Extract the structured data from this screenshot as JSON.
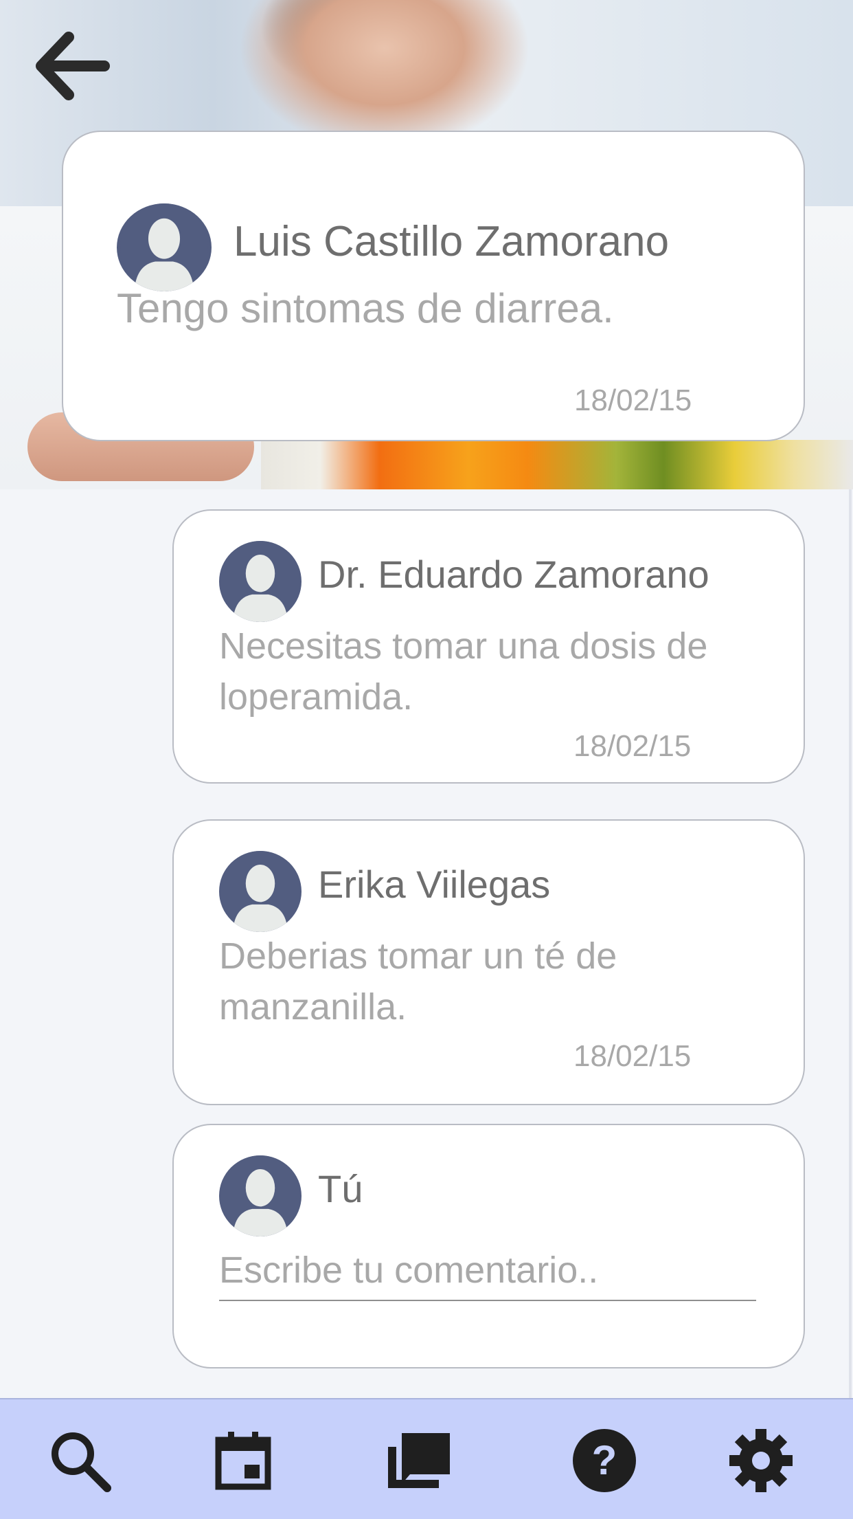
{
  "header": {
    "back_icon": "arrow-left-icon",
    "image": "doctor-fruit-banner"
  },
  "main_post": {
    "author": "Luis Castillo Zamorano",
    "message": "Tengo sintomas de diarrea.",
    "date": "18/02/15",
    "avatar_icon": "user-avatar-icon"
  },
  "comments": [
    {
      "author": "Dr. Eduardo Zamorano",
      "message": "Necesitas tomar una dosis de loperamida.",
      "date": "18/02/15",
      "avatar_icon": "user-avatar-icon"
    },
    {
      "author": "Erika Viilegas",
      "message": "Deberias tomar  un té de manzanilla.",
      "date": "18/02/15",
      "avatar_icon": "user-avatar-icon"
    }
  ],
  "compose": {
    "author": "Tú",
    "placeholder": "Escribe tu comentario..",
    "avatar_icon": "user-avatar-icon"
  },
  "bottom_nav": {
    "items": [
      {
        "icon": "search-icon"
      },
      {
        "icon": "calendar-icon"
      },
      {
        "icon": "messages-icon"
      },
      {
        "icon": "help-icon"
      },
      {
        "icon": "settings-gear-icon"
      }
    ],
    "background": "#c6d0fb"
  },
  "colors": {
    "avatar_bg": "#525d80",
    "name_text": "#6e6e6e",
    "message_text": "#a8a8a8"
  }
}
